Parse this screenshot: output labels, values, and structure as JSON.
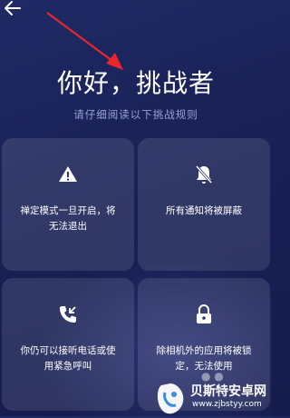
{
  "title": "你好，挑战者",
  "subtitle": "请仔细阅读以下挑战规则",
  "cards": [
    {
      "icon": "warning-icon",
      "text_line1": "禅定模式一旦开启，将",
      "text_line2": "无法退出"
    },
    {
      "icon": "bell-off-icon",
      "text_line1": "所有通知将被屏蔽",
      "text_line2": ""
    },
    {
      "icon": "call-incoming-icon",
      "text_line1": "你仍可以接听电话或使",
      "text_line2": "用紧急呼叫"
    },
    {
      "icon": "lock-icon",
      "text_line1": "除相机外的应用将被锁",
      "text_line2": "定，无法使用"
    }
  ],
  "watermark": {
    "name": "贝斯特安卓网",
    "url": "www.zjbstyy.com"
  },
  "colors": {
    "background": "#1b2358",
    "card": "#2b3471",
    "subtitle": "#9aa3d6",
    "annotation_arrow": "#e8262b"
  }
}
